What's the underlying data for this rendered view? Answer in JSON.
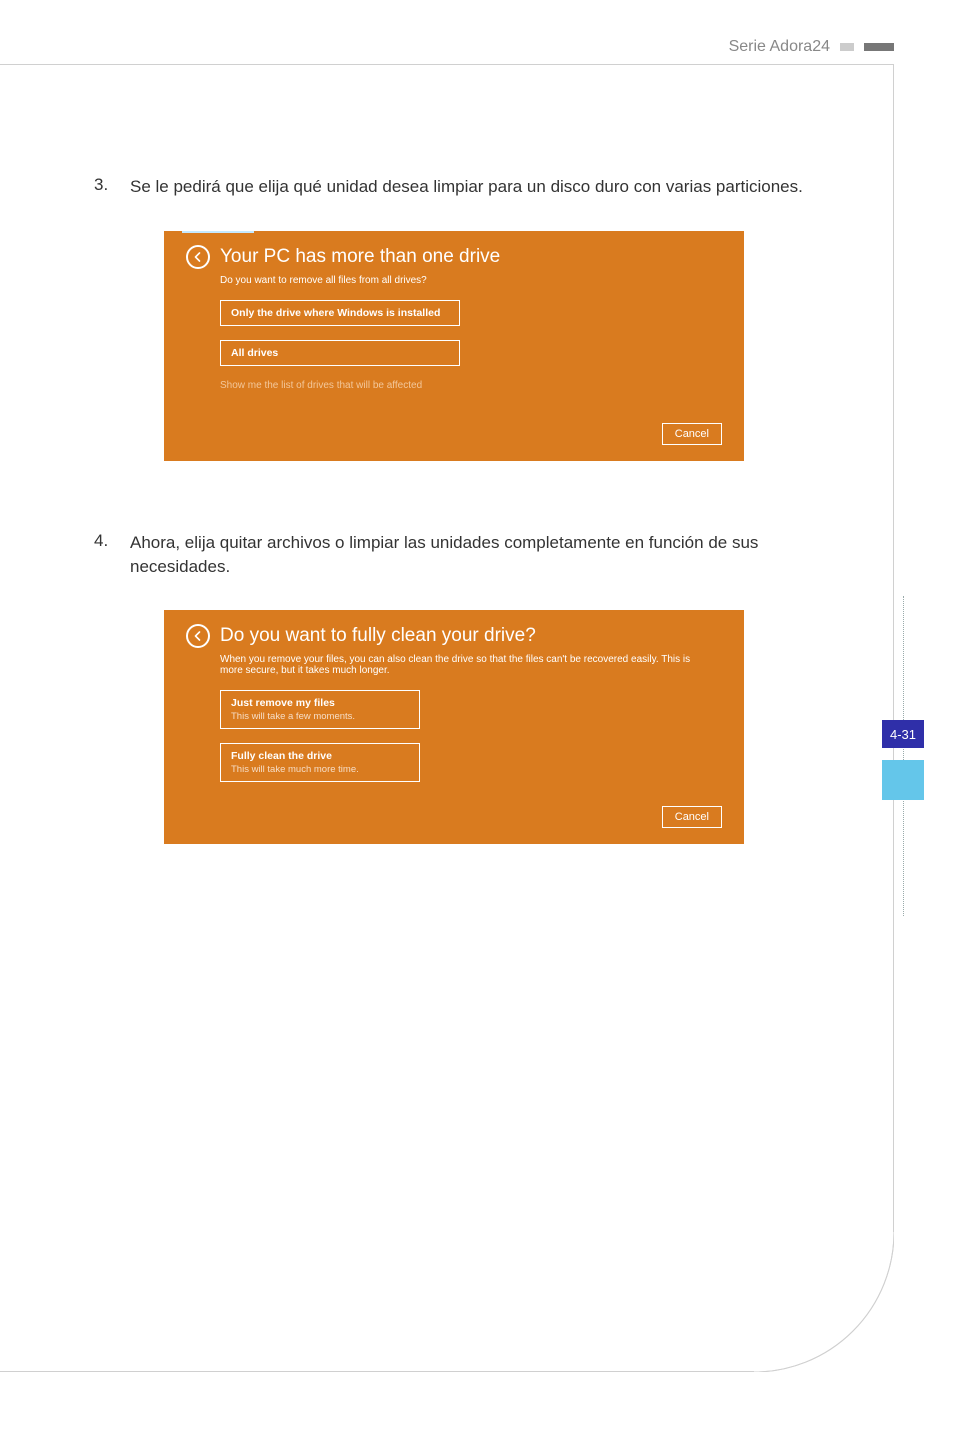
{
  "header": {
    "series": "Serie Adora24"
  },
  "steps": [
    {
      "num": "3.",
      "text": "Se le pedirá que elija qué unidad desea limpiar para un disco duro con varias particiones."
    },
    {
      "num": "4.",
      "text": "Ahora, elija quitar archivos o limpiar las unidades completamente en función de sus necesidades."
    }
  ],
  "dialog1": {
    "title": "Your PC has more than one drive",
    "subtitle": "Do you want to remove all files from all drives?",
    "options": [
      {
        "title": "Only the drive where Windows is installed"
      },
      {
        "title": "All drives"
      }
    ],
    "link": "Show me the list of drives that will be affected",
    "cancel": "Cancel"
  },
  "dialog2": {
    "title": "Do you want to fully clean your drive?",
    "subtitle": "When you remove your files, you can also clean the drive so that the files can't be recovered easily. This is more secure, but it takes much longer.",
    "options": [
      {
        "title": "Just remove my files",
        "sub": "This will take a few moments."
      },
      {
        "title": "Fully clean the drive",
        "sub": "This will take much more time."
      }
    ],
    "cancel": "Cancel"
  },
  "page_number": "4-31",
  "colors": {
    "accent_orange": "#d97b1f",
    "tab_blue": "#2f2fa9",
    "tab_light": "#64c6ea"
  }
}
